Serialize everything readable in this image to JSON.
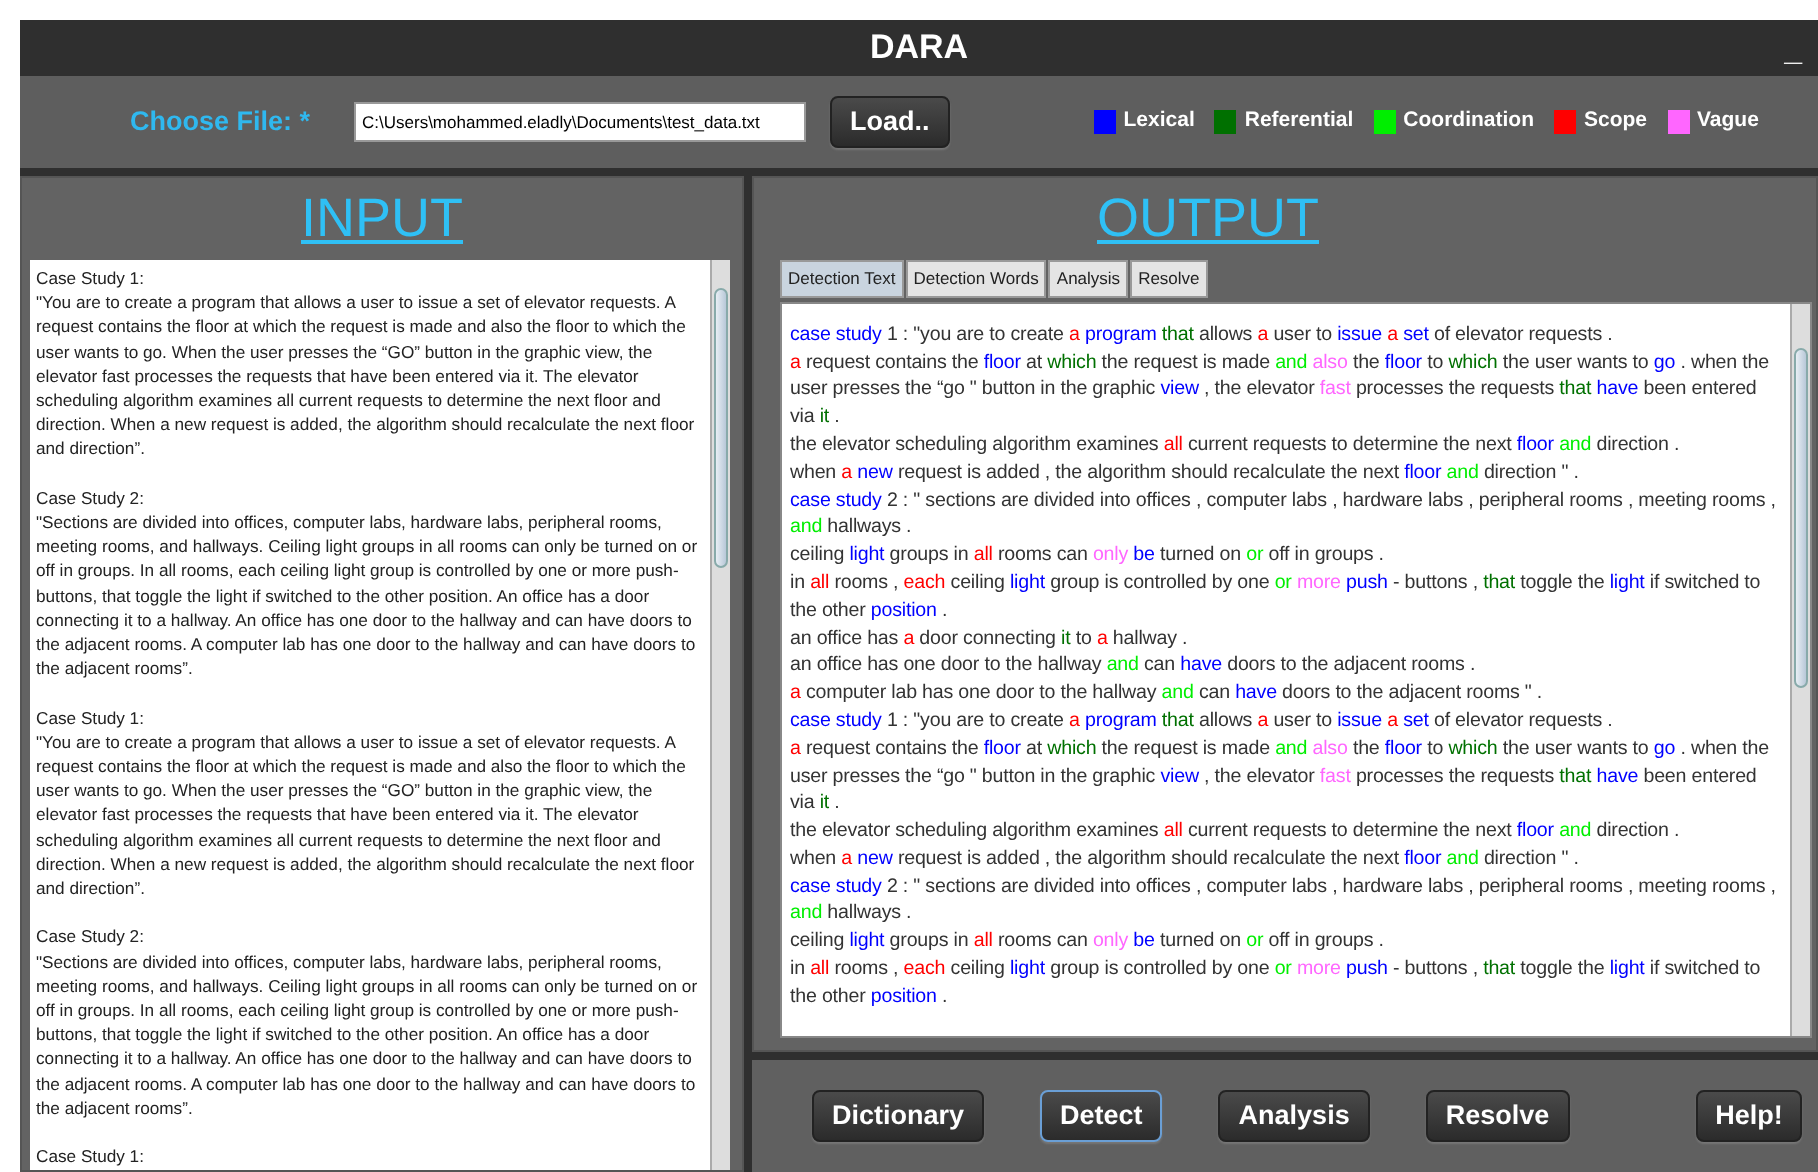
{
  "window": {
    "title": "DARA",
    "controls": [
      "_"
    ]
  },
  "toolbar": {
    "file_label": "Choose File: *",
    "file_path": "C:\\Users\\mohammed.eladly\\Documents\\test_data.txt",
    "load_button": "Load..",
    "legend": [
      {
        "label": "Lexical",
        "kind": "lexical",
        "color": "#0000ff"
      },
      {
        "label": "Referential",
        "kind": "referential",
        "color": "#007000"
      },
      {
        "label": "Coordination",
        "kind": "coordination",
        "color": "#00ee00"
      },
      {
        "label": "Scope",
        "kind": "scope",
        "color": "#ff0000"
      },
      {
        "label": "Vague",
        "kind": "vague",
        "color": "#ff66ff"
      }
    ]
  },
  "input": {
    "title": "INPUT",
    "blocks": [
      {
        "heading": "Case Study 1:",
        "body": "\"You are to create a program that allows a user to issue a set of elevator requests. A request contains the floor at which the request is made and also the floor to which the user wants to go. When the user presses the “GO” button in the graphic view, the elevator fast processes the requests that have been entered via it. The elevator scheduling algorithm examines all current requests to determine the next floor and direction. When a new request is added, the algorithm should recalculate the next floor and direction”."
      },
      {
        "heading": "Case Study 2:",
        "body": "\"Sections are divided into offices, computer labs, hardware labs, peripheral rooms, meeting rooms, and hallways. Ceiling light groups in all rooms can only be turned on or off in groups. In all rooms, each ceiling light group is controlled by one or more push-buttons, that toggle the light if switched to the other position. An office has a door connecting it to a hallway. An office has one door to the hallway and can have doors to the adjacent rooms. A computer lab has one door to the hallway and can have doors to the adjacent rooms”."
      },
      {
        "heading": "Case Study 1:",
        "body": "\"You are to create a program that allows a user to issue a set of elevator requests. A request contains the floor at which the request is made and also the floor to which the user wants to go. When the user presses the “GO” button in the graphic view, the elevator fast processes the requests that have been entered via it. The elevator scheduling algorithm examines all current requests to determine the next floor and direction. When a new request is added, the algorithm should recalculate the next floor and direction”."
      },
      {
        "heading": "Case Study 2:",
        "body": "\"Sections are divided into offices, computer labs, hardware labs, peripheral rooms, meeting rooms, and hallways. Ceiling light groups in all rooms can only be turned on or off in groups. In all rooms, each ceiling light group is controlled by one or more push-buttons, that toggle the light if switched to the other position. An office has a door connecting it to a hallway. An office has one door to the hallway and can have doors to the adjacent rooms. A computer lab has one door to the hallway and can have doors to the adjacent rooms”."
      },
      {
        "heading": "Case Study 1:"
      }
    ]
  },
  "output": {
    "title": "OUTPUT",
    "tabs": [
      {
        "label": "Detection Text",
        "selected": true
      },
      {
        "label": "Detection Words",
        "selected": false
      },
      {
        "label": "Analysis",
        "selected": false
      },
      {
        "label": "Resolve",
        "selected": false
      }
    ],
    "lines": [
      {
        "segments": [
          {
            "text": "case study",
            "kind": "lexical"
          },
          {
            "text": " 1 : \"you are to create ",
            "kind": "plain"
          },
          {
            "text": "a",
            "kind": "scope"
          },
          {
            "text": "program",
            "kind": "lexical"
          },
          {
            "text": "that",
            "kind": "referential"
          },
          {
            "text": " allows ",
            "kind": "plain"
          },
          {
            "text": "a",
            "kind": "scope"
          },
          {
            "text": " user to ",
            "kind": "plain"
          },
          {
            "text": "issue",
            "kind": "lexical"
          },
          {
            "text": "a",
            "kind": "scope"
          },
          {
            "text": "set",
            "kind": "lexical"
          },
          {
            "text": " of elevator requests .",
            "kind": "plain"
          }
        ]
      },
      {
        "segments": [
          {
            "text": "a",
            "kind": "scope"
          },
          {
            "text": " request contains the ",
            "kind": "plain"
          },
          {
            "text": "floor",
            "kind": "lexical"
          },
          {
            "text": " at ",
            "kind": "plain"
          },
          {
            "text": "which",
            "kind": "referential"
          },
          {
            "text": " the request is made ",
            "kind": "plain"
          },
          {
            "text": "and",
            "kind": "coordination"
          },
          {
            "text": "also",
            "kind": "vague"
          },
          {
            "text": " the ",
            "kind": "plain"
          },
          {
            "text": "floor",
            "kind": "lexical"
          },
          {
            "text": " to ",
            "kind": "plain"
          },
          {
            "text": "which",
            "kind": "referential"
          },
          {
            "text": " the user wants to ",
            "kind": "plain"
          },
          {
            "text": "go",
            "kind": "lexical"
          },
          {
            "text": " . when the user presses the “go \" button in the graphic ",
            "kind": "plain"
          },
          {
            "text": "view",
            "kind": "lexical"
          },
          {
            "text": " , the elevator ",
            "kind": "plain"
          },
          {
            "text": "fast",
            "kind": "vague"
          },
          {
            "text": " processes the requests ",
            "kind": "plain"
          },
          {
            "text": "that",
            "kind": "referential"
          },
          {
            "text": "have",
            "kind": "lexical"
          },
          {
            "text": " been entered via ",
            "kind": "plain"
          },
          {
            "text": "it",
            "kind": "referential"
          },
          {
            "text": " .",
            "kind": "plain"
          }
        ]
      },
      {
        "segments": [
          {
            "text": "the elevator scheduling algorithm examines ",
            "kind": "plain"
          },
          {
            "text": "all",
            "kind": "scope"
          },
          {
            "text": " current requests to determine the next ",
            "kind": "plain"
          },
          {
            "text": "floor",
            "kind": "lexical"
          },
          {
            "text": "and",
            "kind": "coordination"
          },
          {
            "text": " direction .",
            "kind": "plain"
          }
        ]
      },
      {
        "segments": [
          {
            "text": "when ",
            "kind": "plain"
          },
          {
            "text": "a",
            "kind": "scope"
          },
          {
            "text": "new",
            "kind": "lexical"
          },
          {
            "text": " request is added , the algorithm should recalculate the next ",
            "kind": "plain"
          },
          {
            "text": "floor",
            "kind": "lexical"
          },
          {
            "text": "and",
            "kind": "coordination"
          },
          {
            "text": " direction \" .",
            "kind": "plain"
          }
        ]
      },
      {
        "segments": [
          {
            "text": "case study",
            "kind": "lexical"
          },
          {
            "text": " 2 : \" sections are divided into offices , computer labs , hardware labs , peripheral rooms , meeting rooms , ",
            "kind": "plain"
          },
          {
            "text": "and",
            "kind": "coordination"
          },
          {
            "text": " hallways .",
            "kind": "plain"
          }
        ]
      },
      {
        "segments": [
          {
            "text": "ceiling ",
            "kind": "plain"
          },
          {
            "text": "light",
            "kind": "lexical"
          },
          {
            "text": " groups in ",
            "kind": "plain"
          },
          {
            "text": "all",
            "kind": "scope"
          },
          {
            "text": " rooms can ",
            "kind": "plain"
          },
          {
            "text": "only",
            "kind": "vague"
          },
          {
            "text": "be",
            "kind": "lexical"
          },
          {
            "text": " turned on ",
            "kind": "plain"
          },
          {
            "text": "or",
            "kind": "coordination"
          },
          {
            "text": " off in groups .",
            "kind": "plain"
          }
        ]
      },
      {
        "segments": [
          {
            "text": "in ",
            "kind": "plain"
          },
          {
            "text": "all",
            "kind": "scope"
          },
          {
            "text": " rooms , ",
            "kind": "plain"
          },
          {
            "text": "each",
            "kind": "scope"
          },
          {
            "text": " ceiling ",
            "kind": "plain"
          },
          {
            "text": "light",
            "kind": "lexical"
          },
          {
            "text": " group is controlled by one ",
            "kind": "plain"
          },
          {
            "text": "or",
            "kind": "coordination"
          },
          {
            "text": "more",
            "kind": "vague"
          },
          {
            "text": "push",
            "kind": "lexical"
          },
          {
            "text": " - buttons , ",
            "kind": "plain"
          },
          {
            "text": "that",
            "kind": "referential"
          },
          {
            "text": " toggle the ",
            "kind": "plain"
          },
          {
            "text": "light",
            "kind": "lexical"
          },
          {
            "text": " if switched to the other ",
            "kind": "plain"
          },
          {
            "text": "position",
            "kind": "lexical"
          },
          {
            "text": " .",
            "kind": "plain"
          }
        ]
      },
      {
        "segments": [
          {
            "text": "an office has ",
            "kind": "plain"
          },
          {
            "text": "a",
            "kind": "scope"
          },
          {
            "text": " door connecting ",
            "kind": "plain"
          },
          {
            "text": "it",
            "kind": "referential"
          },
          {
            "text": " to ",
            "kind": "plain"
          },
          {
            "text": "a",
            "kind": "scope"
          },
          {
            "text": " hallway .",
            "kind": "plain"
          }
        ]
      },
      {
        "segments": [
          {
            "text": "an office has one door to the hallway ",
            "kind": "plain"
          },
          {
            "text": "and",
            "kind": "coordination"
          },
          {
            "text": " can ",
            "kind": "plain"
          },
          {
            "text": "have",
            "kind": "lexical"
          },
          {
            "text": " doors to the adjacent rooms .",
            "kind": "plain"
          }
        ]
      },
      {
        "segments": [
          {
            "text": "a",
            "kind": "scope"
          },
          {
            "text": " computer lab has one door to the hallway ",
            "kind": "plain"
          },
          {
            "text": "and",
            "kind": "coordination"
          },
          {
            "text": " can ",
            "kind": "plain"
          },
          {
            "text": "have",
            "kind": "lexical"
          },
          {
            "text": " doors to the adjacent rooms \" .",
            "kind": "plain"
          }
        ]
      },
      {
        "segments": [
          {
            "text": "case study",
            "kind": "lexical"
          },
          {
            "text": " 1 : \"you are to create ",
            "kind": "plain"
          },
          {
            "text": "a",
            "kind": "scope"
          },
          {
            "text": "program",
            "kind": "lexical"
          },
          {
            "text": "that",
            "kind": "referential"
          },
          {
            "text": " allows ",
            "kind": "plain"
          },
          {
            "text": "a",
            "kind": "scope"
          },
          {
            "text": " user to ",
            "kind": "plain"
          },
          {
            "text": "issue",
            "kind": "lexical"
          },
          {
            "text": "a",
            "kind": "scope"
          },
          {
            "text": "set",
            "kind": "lexical"
          },
          {
            "text": " of elevator requests .",
            "kind": "plain"
          }
        ]
      },
      {
        "segments": [
          {
            "text": "a",
            "kind": "scope"
          },
          {
            "text": " request contains the ",
            "kind": "plain"
          },
          {
            "text": "floor",
            "kind": "lexical"
          },
          {
            "text": " at ",
            "kind": "plain"
          },
          {
            "text": "which",
            "kind": "referential"
          },
          {
            "text": " the request is made ",
            "kind": "plain"
          },
          {
            "text": "and",
            "kind": "coordination"
          },
          {
            "text": "also",
            "kind": "vague"
          },
          {
            "text": " the ",
            "kind": "plain"
          },
          {
            "text": "floor",
            "kind": "lexical"
          },
          {
            "text": " to ",
            "kind": "plain"
          },
          {
            "text": "which",
            "kind": "referential"
          },
          {
            "text": " the user wants to ",
            "kind": "plain"
          },
          {
            "text": "go",
            "kind": "lexical"
          },
          {
            "text": " . when the user presses the “go \" button in the graphic ",
            "kind": "plain"
          },
          {
            "text": "view",
            "kind": "lexical"
          },
          {
            "text": " , the elevator ",
            "kind": "plain"
          },
          {
            "text": "fast",
            "kind": "vague"
          },
          {
            "text": " processes the requests ",
            "kind": "plain"
          },
          {
            "text": "that",
            "kind": "referential"
          },
          {
            "text": "have",
            "kind": "lexical"
          },
          {
            "text": " been entered via ",
            "kind": "plain"
          },
          {
            "text": "it",
            "kind": "referential"
          },
          {
            "text": " .",
            "kind": "plain"
          }
        ]
      },
      {
        "segments": [
          {
            "text": "the elevator scheduling algorithm examines ",
            "kind": "plain"
          },
          {
            "text": "all",
            "kind": "scope"
          },
          {
            "text": " current requests to determine the next ",
            "kind": "plain"
          },
          {
            "text": "floor",
            "kind": "lexical"
          },
          {
            "text": "and",
            "kind": "coordination"
          },
          {
            "text": " direction .",
            "kind": "plain"
          }
        ]
      },
      {
        "segments": [
          {
            "text": "when ",
            "kind": "plain"
          },
          {
            "text": "a",
            "kind": "scope"
          },
          {
            "text": "new",
            "kind": "lexical"
          },
          {
            "text": " request is added , the algorithm should recalculate the next ",
            "kind": "plain"
          },
          {
            "text": "floor",
            "kind": "lexical"
          },
          {
            "text": "and",
            "kind": "coordination"
          },
          {
            "text": " direction \" .",
            "kind": "plain"
          }
        ]
      },
      {
        "segments": [
          {
            "text": "case study",
            "kind": "lexical"
          },
          {
            "text": " 2 : \" sections are divided into offices , computer labs , hardware labs , peripheral rooms , meeting rooms , ",
            "kind": "plain"
          },
          {
            "text": "and",
            "kind": "coordination"
          },
          {
            "text": " hallways .",
            "kind": "plain"
          }
        ]
      },
      {
        "segments": [
          {
            "text": "ceiling ",
            "kind": "plain"
          },
          {
            "text": "light",
            "kind": "lexical"
          },
          {
            "text": " groups in ",
            "kind": "plain"
          },
          {
            "text": "all",
            "kind": "scope"
          },
          {
            "text": " rooms can ",
            "kind": "plain"
          },
          {
            "text": "only",
            "kind": "vague"
          },
          {
            "text": "be",
            "kind": "lexical"
          },
          {
            "text": " turned on ",
            "kind": "plain"
          },
          {
            "text": "or",
            "kind": "coordination"
          },
          {
            "text": " off in groups .",
            "kind": "plain"
          }
        ]
      },
      {
        "segments": [
          {
            "text": "in ",
            "kind": "plain"
          },
          {
            "text": "all",
            "kind": "scope"
          },
          {
            "text": " rooms , ",
            "kind": "plain"
          },
          {
            "text": "each",
            "kind": "scope"
          },
          {
            "text": " ceiling ",
            "kind": "plain"
          },
          {
            "text": "light",
            "kind": "lexical"
          },
          {
            "text": " group is controlled by one ",
            "kind": "plain"
          },
          {
            "text": "or",
            "kind": "coordination"
          },
          {
            "text": "more",
            "kind": "vague"
          },
          {
            "text": "push",
            "kind": "lexical"
          },
          {
            "text": " - buttons , ",
            "kind": "plain"
          },
          {
            "text": "that",
            "kind": "referential"
          },
          {
            "text": " toggle the ",
            "kind": "plain"
          },
          {
            "text": "light",
            "kind": "lexical"
          },
          {
            "text": " if switched to the other ",
            "kind": "plain"
          },
          {
            "text": "position",
            "kind": "lexical"
          },
          {
            "text": " .",
            "kind": "plain"
          }
        ]
      }
    ]
  },
  "buttons": [
    {
      "label": "Dictionary",
      "focused": false
    },
    {
      "label": "Detect",
      "focused": true
    },
    {
      "label": "Analysis",
      "focused": false
    },
    {
      "label": "Resolve",
      "focused": false
    },
    {
      "label": "Help!",
      "focused": false
    }
  ]
}
